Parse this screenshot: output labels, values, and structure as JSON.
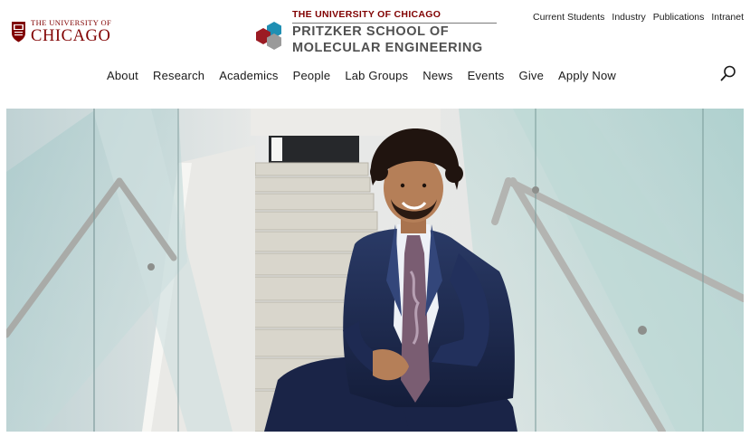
{
  "header": {
    "university_logo": {
      "line1": "THE UNIVERSITY OF",
      "line2": "CHICAGO"
    },
    "school_logo": {
      "university": "THE UNIVERSITY OF CHICAGO",
      "name_line1": "PRITZKER SCHOOL OF",
      "name_line2": "MOLECULAR ENGINEERING"
    },
    "utility_links": [
      "Current Students",
      "Industry",
      "Publications",
      "Intranet"
    ]
  },
  "nav": {
    "items": [
      "About",
      "Research",
      "Academics",
      "People",
      "Lab Groups",
      "News",
      "Events",
      "Give",
      "Apply Now"
    ]
  },
  "icons": {
    "search": "search-icon",
    "crest": "university-crest-icon",
    "school_mark": "hexagon-molecule-icon"
  },
  "colors": {
    "maroon": "#800000",
    "school_gray": "#505050",
    "hex_blue": "#1f8fb3",
    "hex_red": "#9b1b23",
    "hex_gray": "#9a9a9a"
  }
}
